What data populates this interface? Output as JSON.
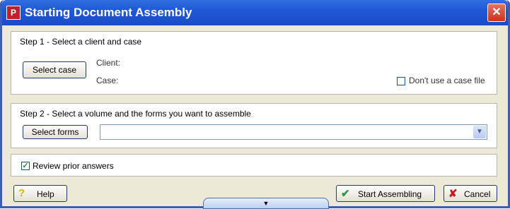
{
  "window": {
    "title": "Starting Document Assembly",
    "app_icon": "P"
  },
  "step1": {
    "label": "Step 1 - Select a client and case",
    "select_case_button": "Select case",
    "client_label": "Client:",
    "case_label": "Case:",
    "no_case_file_checkbox": {
      "label": "Don't use a case file",
      "checked": false
    }
  },
  "step2": {
    "label": "Step 2 - Select a volume and the forms you want to assemble",
    "select_forms_button": "Select forms",
    "forms_dropdown_value": ""
  },
  "review": {
    "label": "Review prior answers",
    "checked": true
  },
  "footer": {
    "help_label": "Help",
    "start_label": "Start Assembling",
    "cancel_label": "Cancel"
  },
  "icons": {
    "help": "question-mark-icon",
    "start": "green-checkmark-icon",
    "cancel": "red-x-icon",
    "expand": "triangle-down-icon"
  },
  "colors": {
    "titlebar": "#1f58d6",
    "window_bg": "#ece9d8"
  }
}
